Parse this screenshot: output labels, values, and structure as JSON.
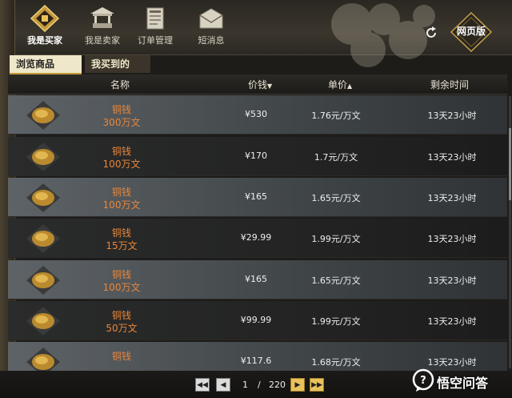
{
  "nav": [
    {
      "label": "我是买家",
      "icon": "coin-bag-icon",
      "active": true
    },
    {
      "label": "我是卖家",
      "icon": "stall-icon",
      "active": false
    },
    {
      "label": "订单管理",
      "icon": "scroll-book-icon",
      "active": false
    },
    {
      "label": "短消息",
      "icon": "envelope-icon",
      "active": false
    }
  ],
  "web_button": {
    "label": "网页版"
  },
  "tabs": [
    {
      "label": "浏览商品",
      "active": true
    },
    {
      "label": "我买到的",
      "active": false
    }
  ],
  "table": {
    "headers": {
      "name": "名称",
      "price": "价钱",
      "unit": "单价",
      "remaining": "剩余时间"
    },
    "rows": [
      {
        "item": "铜钱",
        "amount": "300万文",
        "price": "¥530",
        "unit_price": "1.76元/万文",
        "remaining": "13天23小时"
      },
      {
        "item": "铜钱",
        "amount": "100万文",
        "price": "¥170",
        "unit_price": "1.7元/万文",
        "remaining": "13天23小时"
      },
      {
        "item": "铜钱",
        "amount": "100万文",
        "price": "¥165",
        "unit_price": "1.65元/万文",
        "remaining": "13天23小时"
      },
      {
        "item": "铜钱",
        "amount": "15万文",
        "price": "¥29.99",
        "unit_price": "1.99元/万文",
        "remaining": "13天23小时"
      },
      {
        "item": "铜钱",
        "amount": "100万文",
        "price": "¥165",
        "unit_price": "1.65元/万文",
        "remaining": "13天23小时"
      },
      {
        "item": "铜钱",
        "amount": "50万文",
        "price": "¥99.99",
        "unit_price": "1.99元/万文",
        "remaining": "13天23小时"
      },
      {
        "item": "铜钱",
        "amount": "",
        "price": "¥117.6",
        "unit_price": "1.68元/万文",
        "remaining": "13天23小时"
      }
    ]
  },
  "pager": {
    "current": "1",
    "separator": "/",
    "total": "220"
  },
  "watermark": {
    "text": "悟空问答"
  },
  "colors": {
    "accent": "#e8863a",
    "gold": "#e9c25b"
  }
}
